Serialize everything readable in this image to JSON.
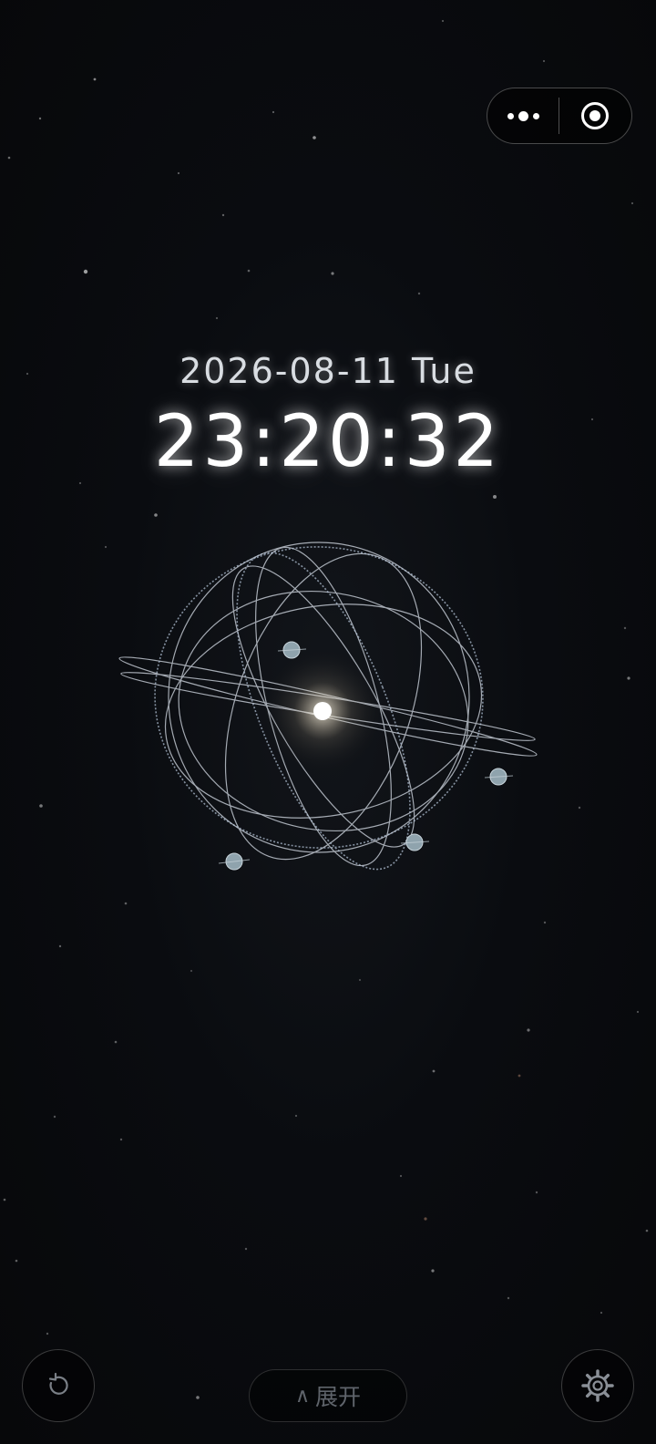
{
  "capsule": {
    "more_icon": "more-dots-icon",
    "close_icon": "target-circle-icon"
  },
  "clock": {
    "date": "2026-08-11 Tue",
    "time": "23:20:32"
  },
  "controls": {
    "refresh_icon": "refresh-icon",
    "expand_chevron": "∧",
    "expand_label": "展开",
    "settings_icon": "gear-icon"
  },
  "colors": {
    "background": "#080a0d",
    "orbit_line": "#cfd8e3",
    "planet": "#8fa3ad",
    "sun": "#ffffff",
    "text": "#ffffff"
  }
}
